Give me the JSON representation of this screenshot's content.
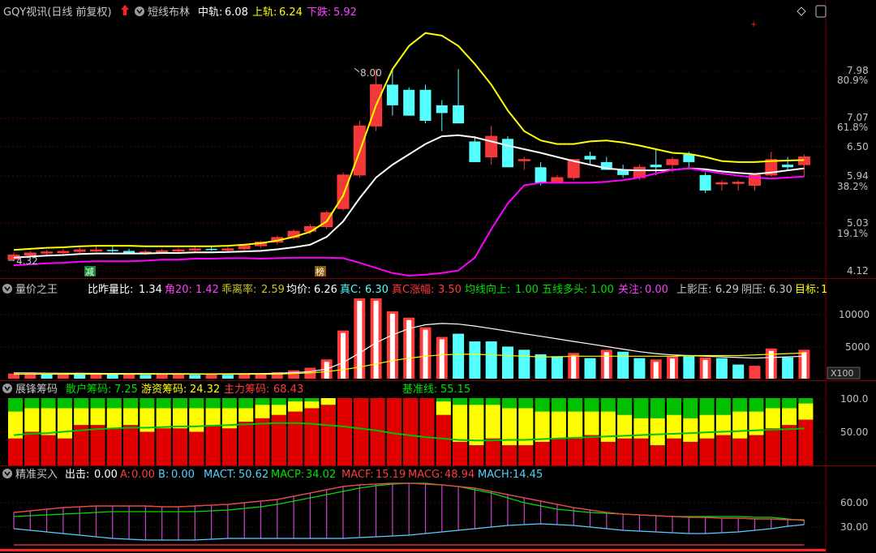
{
  "colors": {
    "up": "#ff3b3b",
    "down": "#54ffff",
    "yellow": "#ffff00",
    "white": "#ffffff",
    "magenta": "#ff00ff",
    "green": "#00c000",
    "grid": "#7a0000",
    "axis_text": "#c0c0c0"
  },
  "main_panel": {
    "title": "GQY视讯(日线 前复权)",
    "indicator_name": "短线布林",
    "mid_label": "中轨:",
    "mid_value": "6.08",
    "upper_label": "上轨:",
    "upper_value": "6.24",
    "lower_label": "下跌:",
    "lower_value": "5.92",
    "marker_high_label": "8.00",
    "marker_low_label": "4.32",
    "badge_left": "减",
    "badge_right": "榜",
    "price_ticks": [
      "7.98",
      "7.07",
      "6.50",
      "5.94",
      "5.03",
      "4.12"
    ],
    "pct_ticks": [
      "80.9%",
      "61.8%",
      "38.2%",
      "19.1%"
    ]
  },
  "volume_panel": {
    "name": "量价之王",
    "items": [
      {
        "label": "比昨量比:",
        "value": "1.34"
      },
      {
        "label": "角20:",
        "value": "1.42"
      },
      {
        "label": "乖离率:",
        "value": "2.59"
      },
      {
        "label": "均价:",
        "value": "6.26"
      },
      {
        "label": "真C:",
        "value": "6.30"
      },
      {
        "label": "真C涨幅:",
        "value": "3.50"
      },
      {
        "label": "均线向上:",
        "value": "1.00"
      },
      {
        "label": "五线多头:",
        "value": "1.00"
      },
      {
        "label": "关注:",
        "value": "0.00"
      },
      {
        "label": "上影压:",
        "value": "6.29"
      },
      {
        "label": "阴压:",
        "value": "6.30"
      },
      {
        "label": "目标:",
        "value": "1"
      }
    ],
    "ticks": [
      "10000",
      "5000"
    ],
    "unit": "X100"
  },
  "chip_panel": {
    "name": "展锋筹码",
    "items": [
      {
        "label": "散户筹码:",
        "value": "7.25"
      },
      {
        "label": "游资筹码:",
        "value": "24.32"
      },
      {
        "label": "主力筹码:",
        "value": "68.43"
      },
      {
        "label": "基准线:",
        "value": "55.15"
      }
    ],
    "ticks": [
      "100.0",
      "50.00"
    ]
  },
  "buy_panel": {
    "name": "精准买入",
    "items": [
      {
        "label": "出击:",
        "value": "0.00"
      },
      {
        "label": "A:",
        "value": "0.00"
      },
      {
        "label": "B:",
        "value": "0.00"
      },
      {
        "label": "MACT:",
        "value": "50.62"
      },
      {
        "label": "MACP:",
        "value": "34.02"
      },
      {
        "label": "MACF:",
        "value": "15.19"
      },
      {
        "label": "MACG:",
        "value": "48.94"
      },
      {
        "label": "MACH:",
        "value": "14.45"
      }
    ],
    "ticks": [
      "60.00",
      "30.00"
    ]
  },
  "chart_data": [
    {
      "type": "candlestick",
      "name": "短线布林",
      "ylim": [
        4.0,
        8.9
      ],
      "ohlc": [
        [
          4.32,
          4.45,
          4.28,
          4.4
        ],
        [
          4.4,
          4.48,
          4.36,
          4.44
        ],
        [
          4.44,
          4.5,
          4.4,
          4.46
        ],
        [
          4.46,
          4.52,
          4.42,
          4.47
        ],
        [
          4.47,
          4.55,
          4.44,
          4.5
        ],
        [
          4.5,
          4.56,
          4.46,
          4.5
        ],
        [
          4.5,
          4.58,
          4.45,
          4.48
        ],
        [
          4.48,
          4.52,
          4.42,
          4.44
        ],
        [
          4.44,
          4.5,
          4.4,
          4.46
        ],
        [
          4.46,
          4.52,
          4.42,
          4.48
        ],
        [
          4.48,
          4.54,
          4.44,
          4.5
        ],
        [
          4.5,
          4.56,
          4.46,
          4.52
        ],
        [
          4.52,
          4.58,
          4.48,
          4.5
        ],
        [
          4.5,
          4.56,
          4.46,
          4.52
        ],
        [
          4.52,
          4.6,
          4.48,
          4.58
        ],
        [
          4.58,
          4.68,
          4.54,
          4.65
        ],
        [
          4.65,
          4.78,
          4.6,
          4.74
        ],
        [
          4.74,
          4.9,
          4.7,
          4.86
        ],
        [
          4.86,
          5.0,
          4.8,
          4.95
        ],
        [
          4.95,
          5.26,
          4.9,
          5.22
        ],
        [
          5.3,
          6.0,
          5.26,
          5.95
        ],
        [
          5.95,
          7.0,
          5.9,
          6.9
        ],
        [
          6.9,
          8.0,
          6.8,
          7.7
        ],
        [
          7.7,
          8.0,
          7.1,
          7.3
        ],
        [
          7.6,
          7.65,
          7.1,
          7.1
        ],
        [
          7.6,
          7.7,
          6.95,
          7.0
        ],
        [
          7.3,
          7.4,
          6.8,
          7.15
        ],
        [
          7.3,
          8.0,
          6.95,
          6.95
        ],
        [
          6.6,
          6.7,
          6.2,
          6.2
        ],
        [
          6.3,
          6.9,
          6.15,
          6.7
        ],
        [
          6.65,
          6.7,
          6.1,
          6.1
        ],
        [
          6.25,
          6.3,
          6.05,
          6.25
        ],
        [
          6.1,
          6.2,
          5.75,
          5.8
        ],
        [
          5.8,
          5.95,
          5.8,
          5.9
        ],
        [
          5.9,
          6.25,
          5.85,
          6.25
        ],
        [
          6.32,
          6.4,
          6.15,
          6.25
        ],
        [
          6.2,
          6.3,
          6.05,
          6.05
        ],
        [
          6.05,
          6.15,
          5.9,
          5.95
        ],
        [
          5.9,
          6.15,
          5.85,
          6.1
        ],
        [
          6.15,
          6.45,
          5.95,
          6.1
        ],
        [
          6.15,
          6.3,
          6.0,
          6.25
        ],
        [
          6.35,
          6.4,
          6.1,
          6.2
        ],
        [
          5.95,
          6.0,
          5.6,
          5.65
        ],
        [
          5.8,
          5.85,
          5.65,
          5.8
        ],
        [
          5.8,
          5.85,
          5.65,
          5.81
        ],
        [
          5.75,
          5.95,
          5.65,
          5.95
        ],
        [
          5.95,
          6.4,
          5.92,
          6.25
        ],
        [
          6.15,
          6.3,
          6.05,
          6.1
        ],
        [
          6.15,
          6.35,
          5.92,
          6.3
        ]
      ],
      "series": [
        {
          "name": "中轨",
          "values": [
            4.35,
            4.37,
            4.39,
            4.4,
            4.42,
            4.43,
            4.43,
            4.43,
            4.43,
            4.44,
            4.44,
            4.45,
            4.45,
            4.46,
            4.47,
            4.48,
            4.51,
            4.55,
            4.6,
            4.75,
            5.05,
            5.5,
            5.9,
            6.15,
            6.35,
            6.55,
            6.7,
            6.72,
            6.68,
            6.6,
            6.52,
            6.45,
            6.38,
            6.3,
            6.22,
            6.15,
            6.08,
            6.05,
            6.04,
            6.04,
            6.05,
            6.08,
            6.06,
            6.02,
            5.99,
            5.97,
            6.0,
            6.04,
            6.08
          ]
        },
        {
          "name": "上轨",
          "values": [
            4.5,
            4.52,
            4.54,
            4.55,
            4.57,
            4.58,
            4.58,
            4.58,
            4.57,
            4.57,
            4.57,
            4.57,
            4.57,
            4.58,
            4.6,
            4.63,
            4.68,
            4.75,
            4.85,
            5.05,
            5.55,
            6.4,
            7.3,
            8.0,
            8.45,
            8.7,
            8.65,
            8.45,
            8.1,
            7.7,
            7.2,
            6.8,
            6.62,
            6.55,
            6.55,
            6.6,
            6.62,
            6.58,
            6.52,
            6.45,
            6.38,
            6.36,
            6.3,
            6.22,
            6.2,
            6.2,
            6.22,
            6.23,
            6.24
          ]
        },
        {
          "name": "下跌",
          "values": [
            4.2,
            4.22,
            4.24,
            4.25,
            4.27,
            4.28,
            4.28,
            4.28,
            4.29,
            4.31,
            4.31,
            4.33,
            4.33,
            4.34,
            4.34,
            4.33,
            4.34,
            4.35,
            4.35,
            4.35,
            4.34,
            4.25,
            4.15,
            4.05,
            4.0,
            4.02,
            4.05,
            4.1,
            4.35,
            4.9,
            5.4,
            5.75,
            5.8,
            5.8,
            5.8,
            5.8,
            5.82,
            5.85,
            5.9,
            5.98,
            6.05,
            6.08,
            6.03,
            5.98,
            5.94,
            5.9,
            5.88,
            5.9,
            5.92
          ]
        }
      ]
    },
    {
      "type": "bar",
      "name": "量价之王",
      "ylim": [
        0,
        12500
      ],
      "values": [
        800,
        800,
        700,
        750,
        700,
        700,
        650,
        650,
        600,
        650,
        700,
        600,
        650,
        600,
        750,
        850,
        1000,
        1300,
        1700,
        3000,
        7500,
        12500,
        12500,
        10500,
        9500,
        8000,
        6500,
        7000,
        5800,
        5800,
        5000,
        4500,
        3800,
        3500,
        4000,
        3200,
        4500,
        4200,
        3200,
        3000,
        3500,
        3500,
        3300,
        3200,
        2200,
        2000,
        4700,
        3300,
        4500
      ],
      "colors": [
        "up",
        "up",
        "down",
        "up",
        "down",
        "up",
        "down",
        "up",
        "down",
        "up",
        "up",
        "down",
        "up",
        "down",
        "up",
        "up",
        "up",
        "up",
        "up",
        "up",
        "up",
        "up",
        "up",
        "up",
        "up",
        "up",
        "up",
        "down",
        "down",
        "down",
        "down",
        "down",
        "down",
        "down",
        "up",
        "down",
        "up",
        "down",
        "down",
        "up",
        "up",
        "down",
        "up",
        "down",
        "down",
        "up",
        "up",
        "down",
        "up"
      ],
      "series": [
        {
          "name": "",
          "values": [
            900,
            880,
            860,
            840,
            830,
            820,
            810,
            800,
            790,
            780,
            770,
            760,
            750,
            760,
            780,
            800,
            850,
            950,
            1100,
            1500,
            2500,
            4000,
            5600,
            6800,
            7800,
            8400,
            8600,
            8500,
            8200,
            7800,
            7400,
            7000,
            6600,
            6200,
            5800,
            5400,
            5000,
            4600,
            4200,
            3900,
            3700,
            3600,
            3500,
            3400,
            3300,
            3200,
            3300,
            3400,
            3500
          ]
        },
        {
          "name": "",
          "values": [
            700,
            700,
            700,
            700,
            700,
            700,
            700,
            700,
            700,
            700,
            700,
            700,
            700,
            700,
            700,
            700,
            700,
            800,
            900,
            1100,
            1400,
            1800,
            2300,
            2800,
            3200,
            3500,
            3700,
            3800,
            3800,
            3700,
            3600,
            3500,
            3400,
            3400,
            3500,
            3500,
            3500,
            3500,
            3500,
            3500,
            3500,
            3600,
            3600,
            3600,
            3600,
            3700,
            3800,
            3900,
            4000
          ]
        }
      ]
    },
    {
      "type": "bar",
      "name": "展锋筹码",
      "ylim": [
        0,
        100
      ],
      "stacked": [
        "主力筹码",
        "游资筹码",
        "散户筹码"
      ],
      "values_main": [
        40,
        50,
        45,
        40,
        60,
        60,
        55,
        60,
        50,
        55,
        55,
        50,
        60,
        55,
        65,
        70,
        75,
        80,
        85,
        90,
        100,
        100,
        100,
        100,
        100,
        100,
        75,
        35,
        30,
        40,
        30,
        30,
        35,
        40,
        40,
        45,
        35,
        40,
        40,
        30,
        40,
        35,
        40,
        45,
        40,
        45,
        55,
        60,
        68
      ],
      "values_youzi": [
        40,
        35,
        40,
        45,
        25,
        25,
        30,
        25,
        35,
        30,
        30,
        35,
        25,
        30,
        20,
        20,
        15,
        15,
        10,
        10,
        0,
        0,
        0,
        0,
        0,
        0,
        20,
        55,
        60,
        50,
        55,
        55,
        45,
        40,
        40,
        35,
        45,
        35,
        30,
        40,
        35,
        35,
        35,
        30,
        40,
        35,
        30,
        25,
        24
      ],
      "series": [
        {
          "name": "基准线",
          "values": [
            45,
            47,
            48,
            50,
            52,
            54,
            55,
            56,
            56,
            57,
            58,
            58,
            59,
            60,
            61,
            62,
            63,
            63,
            62,
            60,
            58,
            55,
            52,
            48,
            45,
            42,
            40,
            38,
            37,
            37,
            38,
            38,
            39,
            40,
            41,
            42,
            43,
            44,
            45,
            46,
            47,
            48,
            49,
            50,
            51,
            52,
            53,
            54,
            55
          ]
        }
      ]
    },
    {
      "type": "line",
      "name": "精准买入",
      "ylim": [
        20,
        100
      ],
      "series": [
        {
          "name": "MACT",
          "values": [
            60,
            62,
            64,
            66,
            67,
            68,
            68,
            68,
            68,
            67,
            67,
            68,
            69,
            70,
            72,
            74,
            76,
            80,
            84,
            88,
            92,
            94,
            95,
            96,
            96,
            95,
            94,
            92,
            90,
            86,
            82,
            78,
            74,
            70,
            66,
            63,
            60,
            58,
            57,
            56,
            55,
            54,
            54,
            53,
            53,
            52,
            52,
            51,
            51
          ]
        },
        {
          "name": "MACP",
          "values": [
            55,
            56,
            57,
            58,
            59,
            60,
            61,
            61,
            61,
            61,
            61,
            61,
            62,
            63,
            65,
            67,
            70,
            74,
            78,
            82,
            86,
            90,
            93,
            95,
            96,
            96,
            94,
            92,
            88,
            84,
            78,
            72,
            68,
            64,
            62,
            60,
            59,
            58,
            57,
            56,
            55,
            55,
            55,
            55,
            55,
            54,
            54,
            52,
            50
          ]
        },
        {
          "name": "MACF",
          "values": [
            20,
            20,
            20,
            20,
            20,
            20,
            20,
            20,
            20,
            20,
            20,
            20,
            20,
            20,
            20,
            20,
            20,
            20,
            20,
            20,
            20,
            20,
            20,
            20,
            20,
            20,
            20,
            20,
            20,
            20,
            20,
            20,
            20,
            20,
            20,
            20,
            20,
            20,
            20,
            20,
            20,
            20,
            20,
            20,
            20,
            20,
            20,
            20,
            20
          ]
        },
        {
          "name": "MACG",
          "values": [
            60,
            62,
            64,
            66,
            67,
            68,
            68,
            68,
            68,
            67,
            67,
            68,
            69,
            70,
            72,
            74,
            76,
            80,
            84,
            88,
            92,
            94,
            95,
            96,
            96,
            95,
            94,
            92,
            90,
            86,
            82,
            78,
            74,
            70,
            66,
            63,
            60,
            58,
            57,
            56,
            55,
            54,
            54,
            53,
            53,
            52,
            52,
            51,
            51
          ]
        },
        {
          "name": "MACH",
          "values": [
            40,
            38,
            36,
            34,
            32,
            30,
            28,
            27,
            26,
            26,
            26,
            26,
            27,
            28,
            28,
            28,
            28,
            28,
            28,
            28,
            28,
            29,
            30,
            31,
            32,
            34,
            36,
            38,
            40,
            42,
            44,
            45,
            46,
            45,
            44,
            42,
            40,
            38,
            37,
            36,
            35,
            34,
            34,
            35,
            36,
            38,
            40,
            43,
            45
          ]
        }
      ]
    }
  ]
}
